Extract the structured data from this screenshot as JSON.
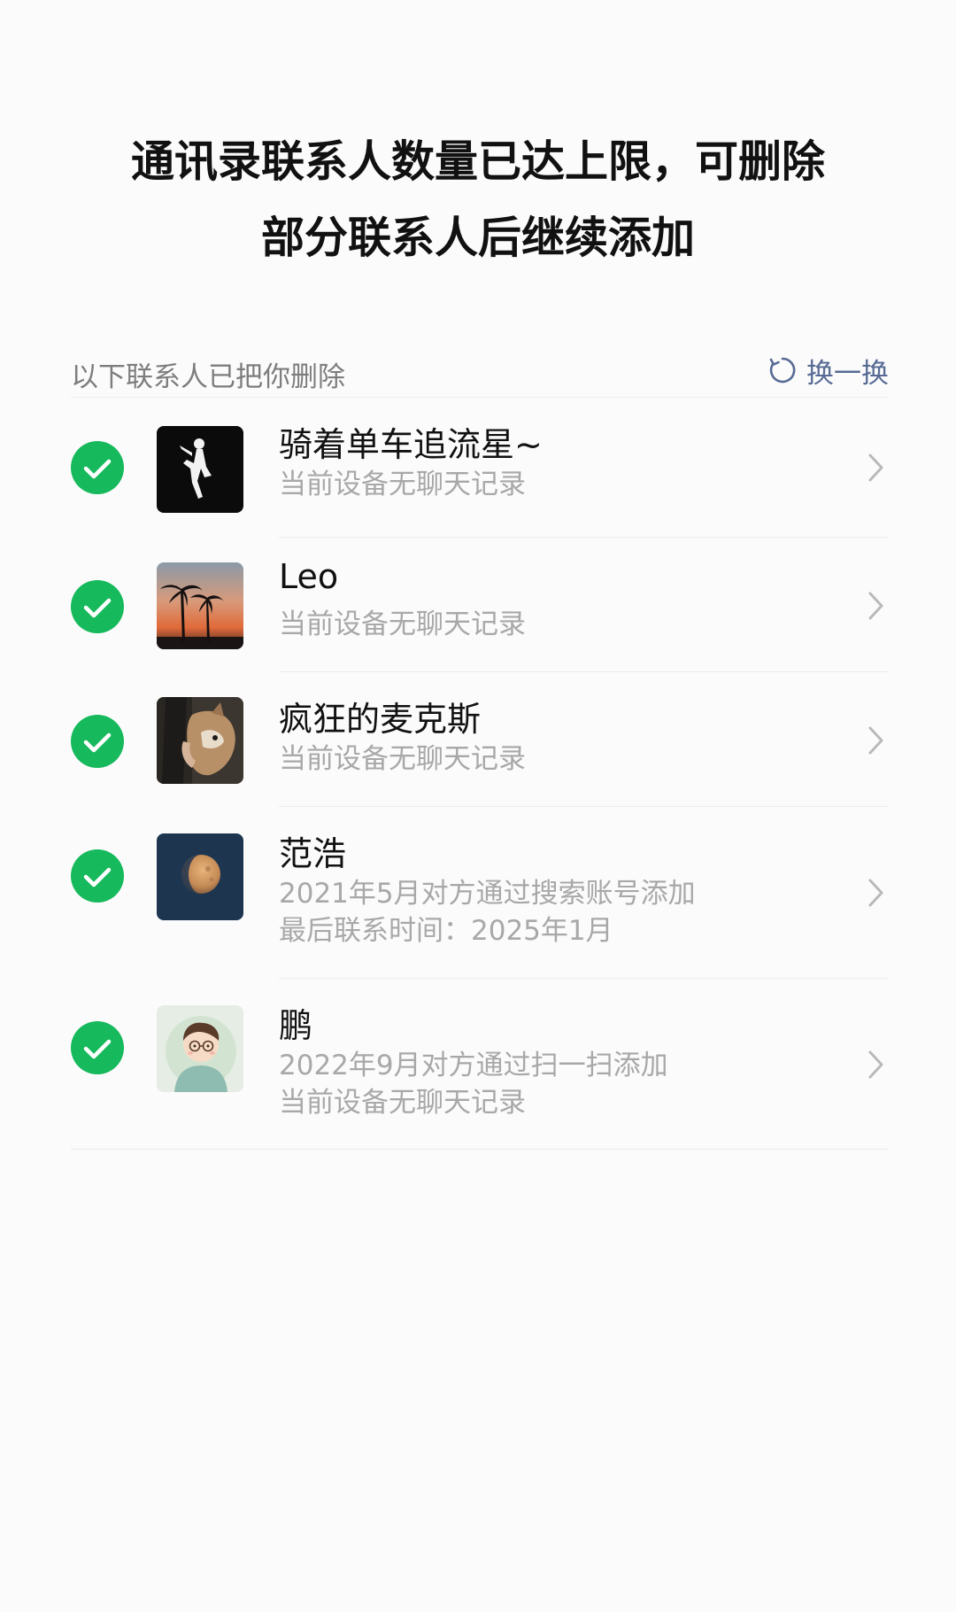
{
  "title": {
    "line1": "通讯录联系人数量已达上限，可删除",
    "line2": "部分联系人后继续添加"
  },
  "section": {
    "label": "以下联系人已把你删除",
    "refresh_label": "换一换"
  },
  "contacts": [
    {
      "name": "骑着单车追流星~",
      "lines": [
        "当前设备无聊天记录"
      ],
      "checked": true,
      "avatar": "sailor-moon-silhouette"
    },
    {
      "name": "Leo",
      "lines": [
        "当前设备无聊天记录"
      ],
      "checked": true,
      "avatar": "palm-tree-sunset"
    },
    {
      "name": "疯狂的麦克斯",
      "lines": [
        "当前设备无聊天记录"
      ],
      "checked": true,
      "avatar": "dog-photo"
    },
    {
      "name": "范浩",
      "lines": [
        "2021年5月对方通过搜索账号添加",
        "最后联系时间：2025年1月"
      ],
      "checked": true,
      "avatar": "moon-night"
    },
    {
      "name": "鹏",
      "lines": [
        "2022年9月对方通过扫一扫添加",
        "当前设备无聊天记录"
      ],
      "checked": true,
      "avatar": "cartoon-boy"
    }
  ],
  "colors": {
    "check_green": "#16b95c",
    "link_blue": "#576b95",
    "secondary_text": "#a8a8a8"
  }
}
